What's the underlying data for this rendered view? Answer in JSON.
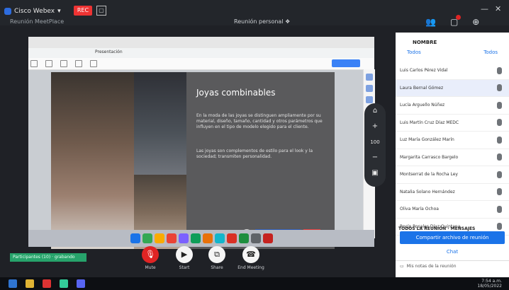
{
  "app": {
    "name": "Cisco Webex",
    "rec_label": "REC",
    "subtitle": "Reunión MeetPlace",
    "window_title": "Reunión personal ❖"
  },
  "browser": {
    "tab_title": "Presentación"
  },
  "slide": {
    "title": "Joyas combinables",
    "para1": "En la moda de las joyas se distinguen ampliamente por su material, diseño, tamaño, cantidad y otros parámetros que influyen en el tipo de modelo elegido para el cliente.",
    "para2": "Las joyas son complementos de estilo para el look y la sociedad; transmiten personalidad."
  },
  "zoom_controls": [
    "⌂",
    "+",
    "100",
    "−",
    "▣"
  ],
  "panel": {
    "title": "NOMBRE",
    "tab_left": "Todos",
    "tab_right": "Todos",
    "participants": [
      {
        "name": "Luis Carlos Pérez Vidal",
        "selected": false
      },
      {
        "name": "Laura Bernal Gómez",
        "selected": true
      },
      {
        "name": "Lucía Arguello Núñez",
        "selected": false
      },
      {
        "name": "Luis Martín Cruz Díaz MEDC",
        "selected": false
      },
      {
        "name": "Luz María González Marín",
        "selected": false
      },
      {
        "name": "Margarita Carrasco Bargelo",
        "selected": false
      },
      {
        "name": "Montserrat de la Rocha Ley",
        "selected": false
      },
      {
        "name": "Natalia Solano Hernández",
        "selected": false
      },
      {
        "name": "Oliva María Ochoa",
        "selected": false
      },
      {
        "name": "Rocío Rosales Díaz Quintana",
        "selected": false
      }
    ],
    "caption": "TODOS LA REUNIÓN · MENSAJES",
    "primary_button": "Compartir archivo de reunión",
    "secondary_link": "Chat",
    "bottom_text": "Mis notas de la reunión"
  },
  "controls": {
    "mute_label": "Mute",
    "video_label": "Start",
    "share_label": "Share",
    "leave_label": "End Meeting"
  },
  "status_pill": "Participantes (10) · grabando",
  "taskbar": {
    "time": "7:54 a.m.",
    "date": "18/05/2022"
  },
  "colors": {
    "accent": "#1b73e8",
    "record": "#e02424",
    "pill": "#27a36b"
  }
}
